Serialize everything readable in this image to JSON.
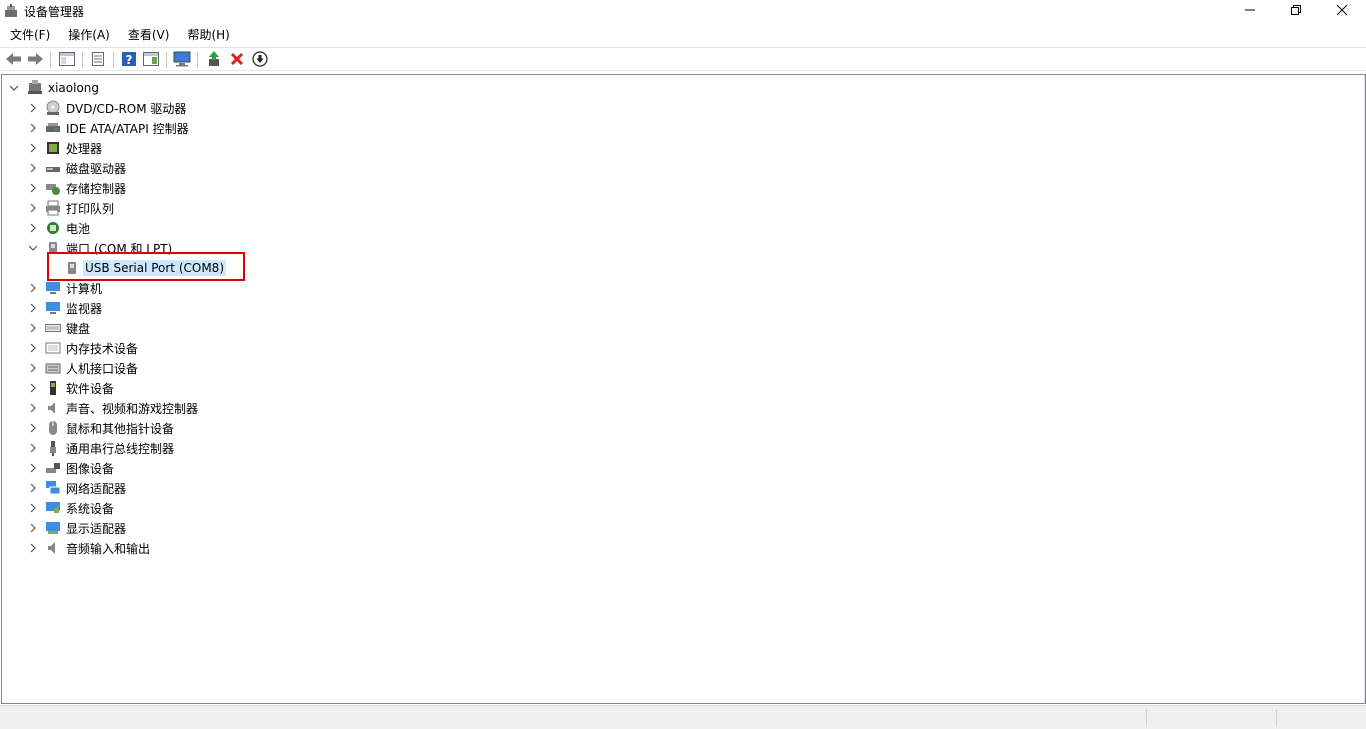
{
  "window": {
    "title": "设备管理器",
    "min_icon": "minimize-icon",
    "max_icon": "restore-icon",
    "close_icon": "close-icon"
  },
  "menu": [
    {
      "label": "文件(F)"
    },
    {
      "label": "操作(A)"
    },
    {
      "label": "查看(V)"
    },
    {
      "label": "帮助(H)"
    }
  ],
  "toolbar": {
    "buttons": [
      {
        "name": "back-icon"
      },
      {
        "name": "forward-icon"
      },
      {
        "name": "show-hide-console-tree-icon"
      },
      {
        "name": "properties-icon"
      },
      {
        "name": "help-icon"
      },
      {
        "name": "action-pane-icon"
      },
      {
        "name": "scan-hardware-icon"
      },
      {
        "name": "update-driver-icon"
      },
      {
        "name": "uninstall-icon"
      },
      {
        "name": "disable-device-icon"
      }
    ]
  },
  "tree": {
    "root": {
      "label": "xiaolong",
      "expanded": true
    },
    "items": [
      {
        "label": "DVD/CD-ROM 驱动器",
        "icon": "dvd-drive-icon"
      },
      {
        "label": "IDE ATA/ATAPI 控制器",
        "icon": "ide-controller-icon"
      },
      {
        "label": "处理器",
        "icon": "processor-icon"
      },
      {
        "label": "磁盘驱动器",
        "icon": "disk-drive-icon"
      },
      {
        "label": "存储控制器",
        "icon": "storage-controller-icon"
      },
      {
        "label": "打印队列",
        "icon": "printer-icon"
      },
      {
        "label": "电池",
        "icon": "battery-icon"
      },
      {
        "label": "端口 (COM 和 LPT)",
        "icon": "port-icon",
        "expanded": true,
        "children": [
          {
            "label": "USB Serial Port (COM8)",
            "icon": "serial-port-icon",
            "selected": true
          }
        ]
      },
      {
        "label": "计算机",
        "icon": "computer-icon"
      },
      {
        "label": "监视器",
        "icon": "monitor-icon"
      },
      {
        "label": "键盘",
        "icon": "keyboard-icon"
      },
      {
        "label": "内存技术设备",
        "icon": "memory-device-icon"
      },
      {
        "label": "人机接口设备",
        "icon": "hid-icon"
      },
      {
        "label": "软件设备",
        "icon": "software-device-icon"
      },
      {
        "label": "声音、视频和游戏控制器",
        "icon": "sound-icon"
      },
      {
        "label": "鼠标和其他指针设备",
        "icon": "mouse-icon"
      },
      {
        "label": "通用串行总线控制器",
        "icon": "usb-icon"
      },
      {
        "label": "图像设备",
        "icon": "camera-icon"
      },
      {
        "label": "网络适配器",
        "icon": "network-adapter-icon"
      },
      {
        "label": "系统设备",
        "icon": "system-device-icon"
      },
      {
        "label": "显示适配器",
        "icon": "display-adapter-icon"
      },
      {
        "label": "音频输入和输出",
        "icon": "audio-io-icon"
      }
    ]
  },
  "colors": {
    "selection": "#cce8ff",
    "highlight_box": "#e00000"
  }
}
